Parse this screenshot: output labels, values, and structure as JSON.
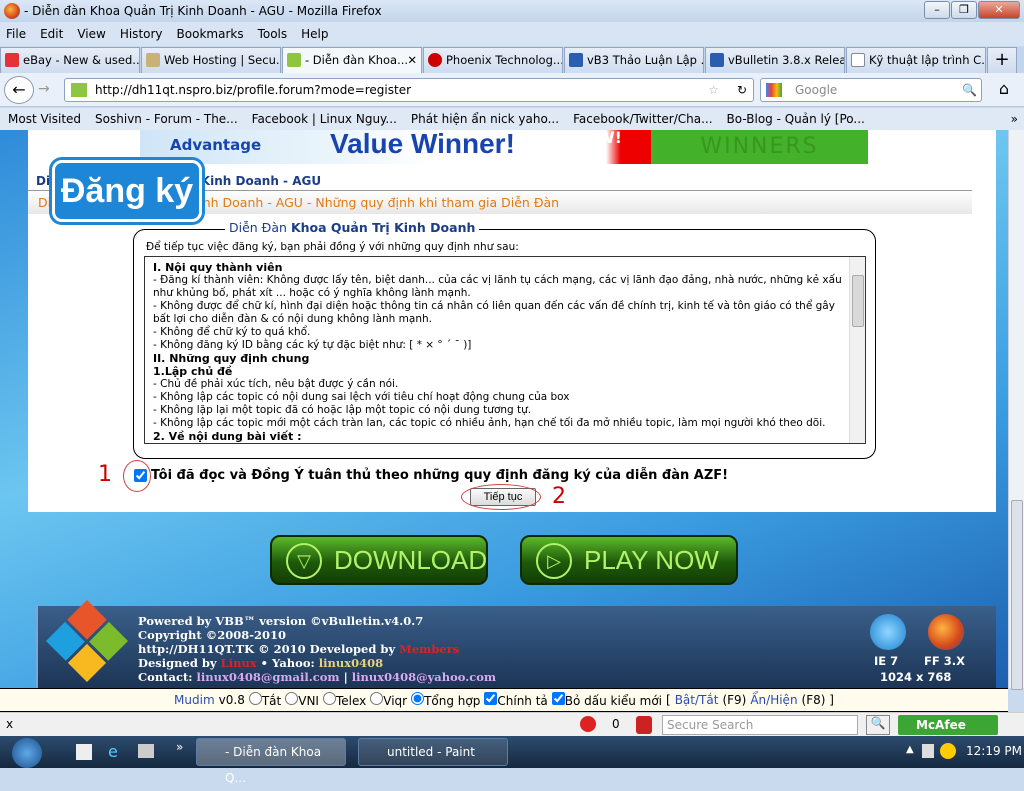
{
  "window": {
    "title": "- Diễn đàn Khoa Quản Trị Kinh Doanh - AGU - Mozilla Firefox"
  },
  "menu": [
    "File",
    "Edit",
    "View",
    "History",
    "Bookmarks",
    "Tools",
    "Help"
  ],
  "tabs": [
    {
      "label": "eBay - New & used...",
      "icon": "ebay-icon"
    },
    {
      "label": "Web Hosting | Secu...",
      "icon": "hosting-icon"
    },
    {
      "label": "- Diễn đàn Khoa...",
      "icon": "forum-icon",
      "active": true
    },
    {
      "label": "Phoenix Technolog...",
      "icon": "phoenix-icon"
    },
    {
      "label": "vB3 Thảo Luận Lập ...",
      "icon": "vb-icon"
    },
    {
      "label": "vBulletin 3.8.x Relea...",
      "icon": "vb-icon"
    },
    {
      "label": "Kỹ thuật lập trình C...",
      "icon": "page-icon"
    }
  ],
  "nav": {
    "url": "http://dh11qt.nspro.biz/profile.forum?mode=register",
    "search_placeholder": "Google"
  },
  "bookmarks": [
    "Most Visited",
    "Soshivn - Forum - The...",
    "Facebook | Linux Nguy...",
    "Phát hiện ẩn nick yaho...",
    "Facebook/Twitter/Cha...",
    "Bo-Blog - Quản lý [Po..."
  ],
  "page": {
    "banner": {
      "left": "Advantage",
      "main": "Value Winner!",
      "now": "NOW!",
      "right": "WINNERS"
    },
    "logo": "Đăng ký",
    "crumb1": "Diễn Đàn Khoa Quản Trị Kinh Doanh - AGU",
    "crumb2": "Diễn Đàn Khoa Quản Trị Kinh Doanh - AGU - Những quy định khi tham gia Diễn Đàn",
    "legend_prefix": "Diễn Đàn",
    "legend_bold": "Khoa Quản Trị Kinh Doanh",
    "intro": "Để tiếp tục việc đăng ký, bạn phải đồng ý với những quy định như sau:",
    "rules": [
      {
        "t": "I. Nội quy thành viên",
        "h": true
      },
      {
        "t": "- Đăng kí thành viên: Không được lấy tên, biệt danh... của các vị lãnh tụ cách mạng, các vị lãnh đạo đảng, nhà nước, những kẻ xấu như khủng bố, phát xít ... hoặc có ý nghĩa không lành mạnh."
      },
      {
        "t": "- Không được để chữ kí, hình đại diện hoặc thông tin cá nhân có liên quan đến các vấn đề chính trị, kinh tế và tôn giáo có thể gây bất lợi cho diễn đàn & có nội dung không lành mạnh."
      },
      {
        "t": "- Không để chữ ký to quá khổ."
      },
      {
        "t": "- Không đăng ký ID bằng các ký tự đặc biệt như: [ * × ° ´ ¯ )]"
      },
      {
        "t": "II. Những quy định chung",
        "h": true
      },
      {
        "t": "1.Lập chủ đề",
        "h": true
      },
      {
        "t": "- Chủ đề phải xúc tích, nêu bật được ý cần nói."
      },
      {
        "t": "- Không lập các topic có nội dung sai lệch với tiêu chí hoạt động chung của box"
      },
      {
        "t": "- Không lặp lại một topic đã có hoặc lập một topic có nội dung tương tự."
      },
      {
        "t": "- Không lập các topic mới một cách tràn lan, các topic có nhiều ảnh, hạn chế tối đa mở nhiều topic, làm mọi người khó theo dõi."
      },
      {
        "t": "2. Về nội dung bài viết :",
        "h": true
      }
    ],
    "agree_label": "Tôi đã đọc và Đồng Ý tuân thủ theo những quy định đăng ký của diễn đàn AZF!",
    "agree_checked": true,
    "annotation1": "1",
    "annotation2": "2",
    "continue_label": "Tiếp tục",
    "download_label": "DOWNLOAD",
    "playnow_label": "PLAY NOW"
  },
  "footer": {
    "line1": "Powered by VBB™ version ©vBulletin.v4.0.7",
    "line2": "Copyright ©2008-2010",
    "line3a": "http://DH11QT.TK © 2010 Developed by ",
    "line3b": "Members",
    "line4a": "Designed by ",
    "line4b": "Linux",
    "line4c": " • Yahoo: ",
    "line4d": "linux0408",
    "line5a": "Contact: ",
    "line5b": "linux0408@gmail.com",
    "line5c": " | ",
    "line5d": "linux0408@yahoo.com",
    "ie": "IE 7",
    "ff": "FF 3.X",
    "res": "1024 x 768"
  },
  "mudim": {
    "name": "Mudim",
    "version": "v0.8",
    "options": [
      "Tắt",
      "VNI",
      "Telex",
      "Viqr",
      "Tổng hợp"
    ],
    "selected": "Tổng hợp",
    "spell": "Chính tả",
    "newtone": "Bỏ dấu kiểu mới",
    "toggle_open": "[",
    "toggle": "Bật/Tắt",
    "toggle_key": "(F9)",
    "show": "Ẩn/Hiện",
    "show_key": "(F8) ]"
  },
  "status": {
    "close": "x",
    "count": "0",
    "secure_search": "Secure Search",
    "mcafee": "McAfee"
  },
  "taskbar": {
    "tasks": [
      "- Diễn đàn Khoa Q...",
      "untitled - Paint"
    ],
    "time": "12:19 PM",
    "more": "»"
  }
}
